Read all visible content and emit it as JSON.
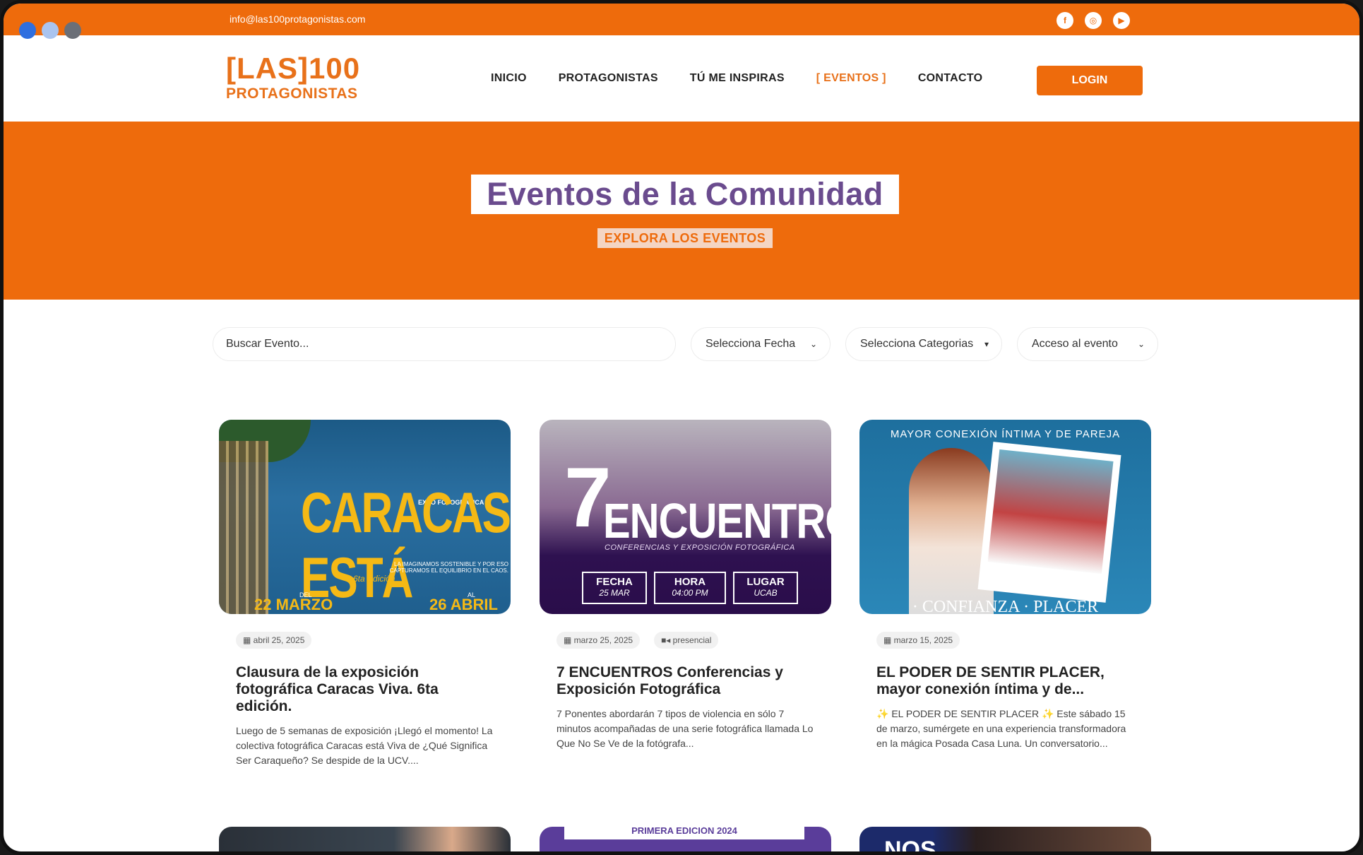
{
  "topbar": {
    "email": "info@las100protagonistas.com",
    "social": [
      {
        "icon": "facebook-icon",
        "glyph": "f"
      },
      {
        "icon": "instagram-icon",
        "glyph": "◎"
      },
      {
        "icon": "youtube-icon",
        "glyph": "▶"
      }
    ]
  },
  "brand": {
    "line1": "[LAS]100",
    "line2": "PROTAGONISTAS",
    "color": "#e8711a"
  },
  "nav": {
    "items": [
      "INICIO",
      "PROTAGONISTAS",
      "TÚ ME INSPIRAS",
      "[ EVENTOS ]",
      "CONTACTO"
    ],
    "active_index": 3,
    "login_label": "LOGIN"
  },
  "hero": {
    "title": "Eventos de la Comunidad",
    "subtitle": "EXPLORA LOS EVENTOS",
    "bg_color": "#ee6b0c",
    "title_color": "#6a4b8e"
  },
  "filters": {
    "search_placeholder": "Buscar Evento...",
    "date": "Selecciona Fecha",
    "categories": "Selecciona Categorias",
    "access": "Acceso al evento"
  },
  "cards": [
    {
      "date": "abril 25, 2025",
      "mode": "",
      "title": "Clausura de la exposición fotográfica Caracas Viva. 6ta edición.",
      "description": "Luego de 5 semanas de exposición ¡Llegó el momento! La colectiva fotográfica Caracas está Viva de ¿Qué Significa Ser Caraqueño? Se despide de la UCV....",
      "image": {
        "kicker": "EXPO FOTOGRÁFICA",
        "headline": "CARACAS ESTÁ VIVA",
        "tagline": "LA IMAGINAMOS SOSTENIBLE Y POR ESO CAPTURAMOS EL EQUILIBRIO EN EL CAOS.",
        "edition": "6ta Edición",
        "from_label": "DEL",
        "to_label": "AL",
        "from_date": "22 MARZO",
        "to_date": "26 ABRIL"
      }
    },
    {
      "date": "marzo 25, 2025",
      "mode": "presencial",
      "title": "7 ENCUENTROS Conferencias y Exposición Fotográfica",
      "description": "7 Ponentes abordarán 7 tipos de violencia en sólo 7 minutos acompañadas de una serie fotográfica llamada Lo Que No Se Ve de la fotógrafa...",
      "image": {
        "number": "7",
        "headline": "ENCUENTROS",
        "tagline": "CONFERENCIAS Y EXPOSICIÓN FOTOGRÁFICA",
        "boxes": [
          {
            "label": "FECHA",
            "value": "25 MAR"
          },
          {
            "label": "HORA",
            "value": "04:00 PM"
          },
          {
            "label": "LUGAR",
            "value": "UCAB"
          }
        ]
      }
    },
    {
      "date": "marzo 15, 2025",
      "mode": "",
      "title": "EL PODER DE SENTIR PLACER, mayor conexión íntima y de...",
      "description": "✨ EL PODER DE SENTIR PLACER ✨ Este sábado 15 de marzo, sumérgete en una experiencia transformadora en la mágica Posada Casa Luna. Un conversatorio...",
      "image": {
        "top_text": "MAYOR CONEXIÓN ÍNTIMA Y DE PAREJA",
        "bottom_text": "· CONFIANZA · PLACER"
      }
    }
  ],
  "bottom_cards": {
    "second_banner": "PRIMERA EDICIÓN 2024",
    "third_word": "NOS"
  }
}
